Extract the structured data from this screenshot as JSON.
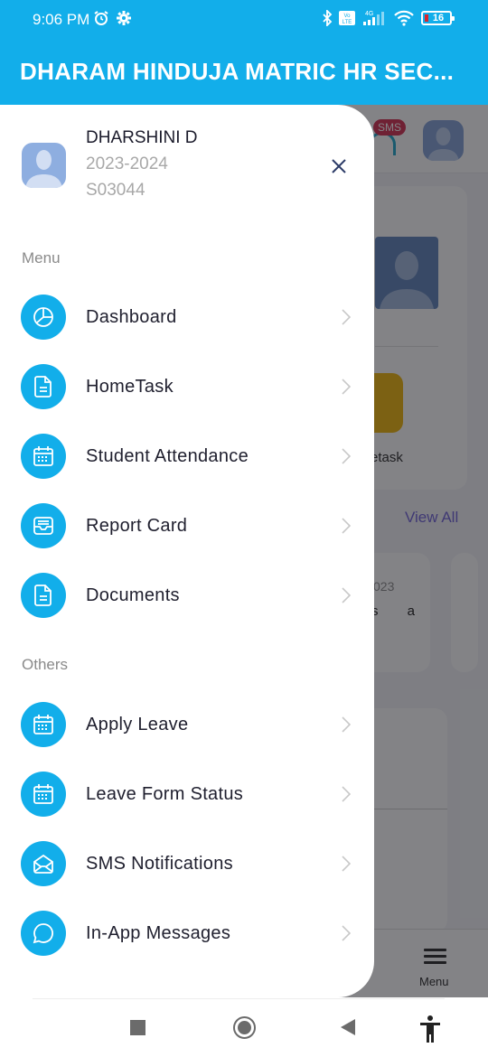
{
  "status_bar": {
    "time": "9:06 PM",
    "battery_level": "16",
    "network": "4G",
    "icons": [
      "alarm-icon",
      "settings-gear-icon",
      "bluetooth-icon",
      "volte-icon",
      "signal-icon",
      "wifi-icon",
      "battery-icon"
    ]
  },
  "app_bar": {
    "title": "DHARAM HINDUJA MATRIC HR SEC..."
  },
  "background": {
    "sms_badge": "SMS",
    "hometask_label": "etask",
    "view_all": "View All",
    "card_date": "023",
    "card_text": "s a",
    "bottom_nav_menu_label": "Menu"
  },
  "drawer": {
    "profile": {
      "name": "DHARSHINI D",
      "academic_year": "2023-2024",
      "student_id": "S03044"
    },
    "sections": [
      {
        "label": "Menu",
        "items": [
          {
            "label": "Dashboard",
            "icon": "pie-chart-icon"
          },
          {
            "label": "HomeTask",
            "icon": "document-icon"
          },
          {
            "label": "Student Attendance",
            "icon": "calendar-icon"
          },
          {
            "label": "Report Card",
            "icon": "inbox-tray-icon"
          },
          {
            "label": "Documents",
            "icon": "document-icon"
          }
        ]
      },
      {
        "label": "Others",
        "items": [
          {
            "label": "Apply Leave",
            "icon": "calendar-icon"
          },
          {
            "label": "Leave Form Status",
            "icon": "calendar-icon"
          },
          {
            "label": "SMS Notifications",
            "icon": "envelope-open-icon"
          },
          {
            "label": "In-App Messages",
            "icon": "chat-bubble-icon"
          }
        ]
      }
    ]
  },
  "colors": {
    "primary": "#12AEEA",
    "drawer_bg": "#FFFFFF",
    "section_label": "#8A8A8A",
    "item_text": "#1F1F2E",
    "badge": "#D2264B"
  }
}
